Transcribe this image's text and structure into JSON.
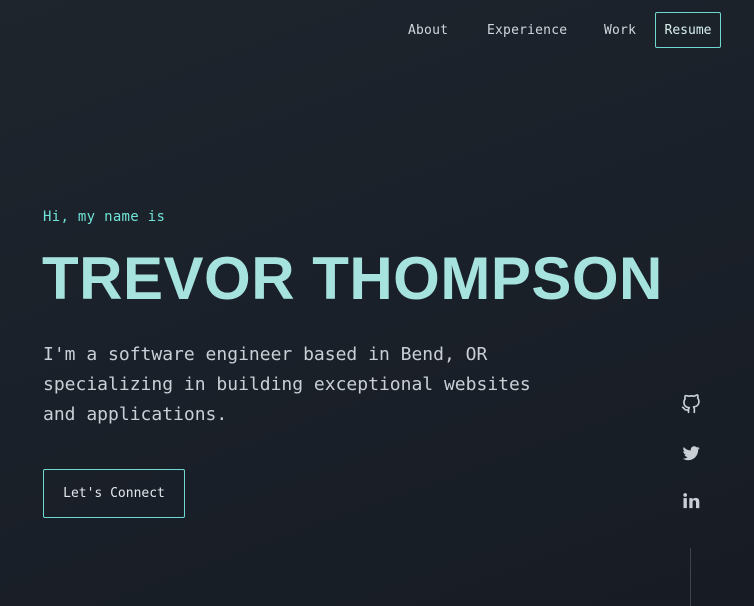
{
  "nav": {
    "links": [
      {
        "label": "About"
      },
      {
        "label": "Experience"
      },
      {
        "label": "Work"
      }
    ],
    "resume_label": "Resume"
  },
  "hero": {
    "greeting": "Hi, my name is",
    "name": "TREVOR THOMPSON",
    "tagline_lines": [
      "I'm a software engineer based in Bend, OR",
      "specializing in building exceptional websites",
      "and applications."
    ],
    "cta_label": "Let's Connect"
  },
  "social": {
    "icons": [
      "github-icon",
      "twitter-icon",
      "linkedin-icon"
    ]
  },
  "colors": {
    "accent": "#6fe3d8",
    "name": "#a6e2de",
    "background": "#1b2129",
    "text": "#c9cfd5"
  }
}
